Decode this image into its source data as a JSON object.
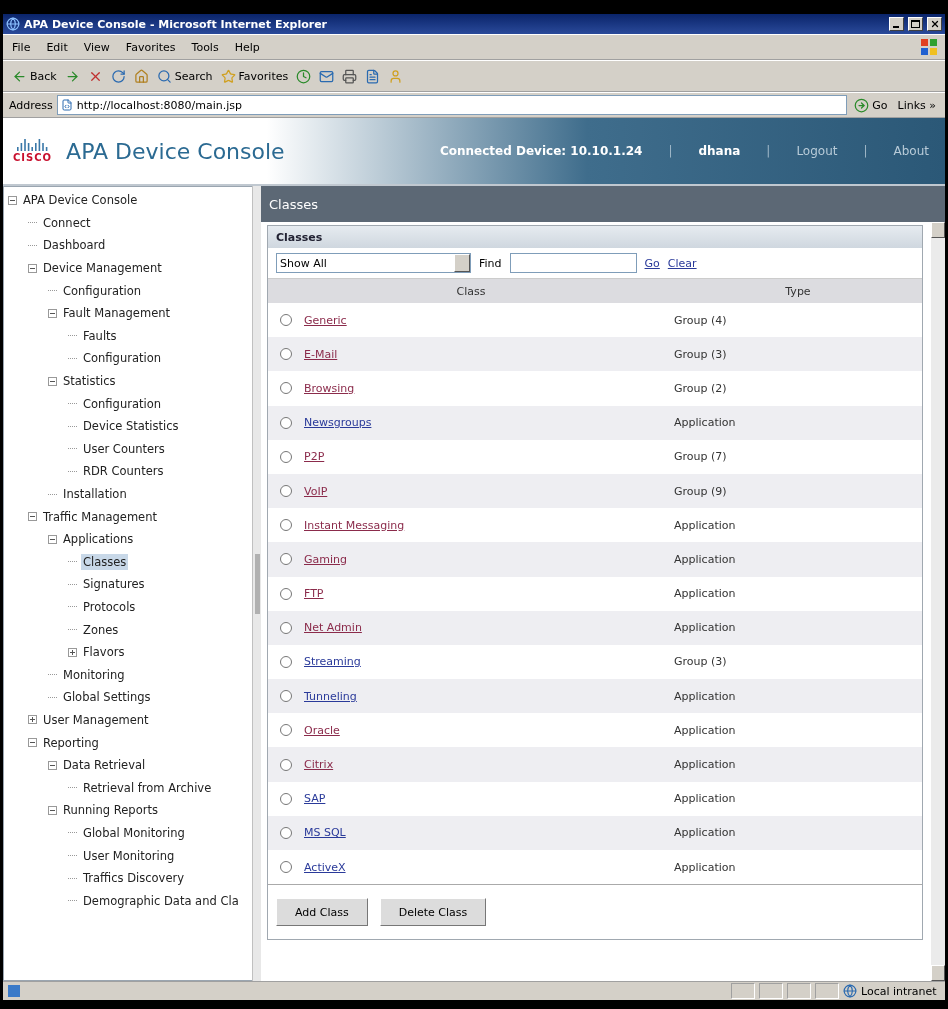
{
  "window": {
    "title": "APA Device Console - Microsoft Internet Explorer"
  },
  "menu": [
    "File",
    "Edit",
    "View",
    "Favorites",
    "Tools",
    "Help"
  ],
  "toolbar": [
    {
      "kind": "back",
      "label": "Back"
    },
    {
      "kind": "forward"
    },
    {
      "kind": "stop"
    },
    {
      "kind": "refresh"
    },
    {
      "kind": "home"
    },
    {
      "kind": "search",
      "label": "Search"
    },
    {
      "kind": "favorites",
      "label": "Favorites"
    },
    {
      "kind": "history"
    },
    {
      "kind": "mail"
    },
    {
      "kind": "print"
    },
    {
      "kind": "edit"
    },
    {
      "kind": "messenger"
    }
  ],
  "address": {
    "label": "Address",
    "value": "http://localhost:8080/main.jsp",
    "go": "Go",
    "links": "Links",
    "more": "»"
  },
  "header": {
    "logo_text": "CISCO",
    "title": "APA Device Console",
    "items": [
      {
        "kind": "label",
        "text": "Connected Device: 10.10.1.24"
      },
      {
        "kind": "separator",
        "text": "|"
      },
      {
        "kind": "user",
        "text": "dhana"
      },
      {
        "kind": "separator",
        "text": "|"
      },
      {
        "kind": "link",
        "text": "Logout"
      },
      {
        "kind": "separator",
        "text": "|"
      },
      {
        "kind": "link",
        "text": "About"
      }
    ]
  },
  "sidebar": {
    "items": [
      {
        "label": "APA Device Console",
        "expanded": true,
        "selected": false,
        "children": [
          {
            "label": "Connect",
            "selected": false
          },
          {
            "label": "Dashboard",
            "selected": false
          },
          {
            "label": "Device Management",
            "expanded": true,
            "selected": false,
            "children": [
              {
                "label": "Configuration",
                "selected": false
              },
              {
                "label": "Fault Management",
                "expanded": true,
                "selected": false,
                "children": [
                  {
                    "label": "Faults",
                    "selected": false
                  },
                  {
                    "label": "Configuration",
                    "selected": false
                  }
                ]
              },
              {
                "label": "Statistics",
                "expanded": true,
                "selected": false,
                "children": [
                  {
                    "label": "Configuration",
                    "selected": false
                  },
                  {
                    "label": "Device Statistics",
                    "selected": false
                  },
                  {
                    "label": "User Counters",
                    "selected": false
                  },
                  {
                    "label": "RDR Counters",
                    "selected": false
                  }
                ]
              },
              {
                "label": "Installation",
                "selected": false
              }
            ]
          },
          {
            "label": "Traffic Management",
            "expanded": true,
            "selected": false,
            "children": [
              {
                "label": "Applications",
                "expanded": true,
                "selected": false,
                "children": [
                  {
                    "label": "Classes",
                    "selected": true
                  },
                  {
                    "label": "Signatures",
                    "selected": false
                  },
                  {
                    "label": "Protocols",
                    "selected": false
                  },
                  {
                    "label": "Zones",
                    "selected": false
                  },
                  {
                    "label": "Flavors",
                    "expanded": false,
                    "selected": false
                  }
                ]
              },
              {
                "label": "Monitoring",
                "selected": false
              },
              {
                "label": "Global Settings",
                "selected": false
              }
            ]
          },
          {
            "label": "User Management",
            "expanded": false,
            "selected": false
          },
          {
            "label": "Reporting",
            "expanded": true,
            "selected": false,
            "children": [
              {
                "label": "Data Retrieval",
                "expanded": true,
                "selected": false,
                "children": [
                  {
                    "label": "Retrieval from Archive",
                    "selected": false
                  }
                ]
              },
              {
                "label": "Running Reports",
                "expanded": true,
                "selected": false,
                "children": [
                  {
                    "label": "Global Monitoring",
                    "selected": false
                  },
                  {
                    "label": "User Monitoring",
                    "selected": false
                  },
                  {
                    "label": "Traffics Discovery",
                    "selected": false
                  },
                  {
                    "label": "Demographic Data and Cla",
                    "selected": false
                  }
                ]
              }
            ]
          }
        ]
      }
    ]
  },
  "page_title": "Classes",
  "panel": {
    "title": "Classes",
    "filter": "Show All",
    "find_label": "Find",
    "go": "Go",
    "clear": "Clear",
    "columns": [
      "Class",
      "Type"
    ],
    "rows": [
      {
        "name": "Generic",
        "type": "Group (4)",
        "visited": true,
        "selected": false
      },
      {
        "name": "E-Mail",
        "type": "Group (3)",
        "visited": true,
        "selected": false
      },
      {
        "name": "Browsing",
        "type": "Group (2)",
        "visited": true,
        "selected": false
      },
      {
        "name": "Newsgroups",
        "type": "Application",
        "visited": false,
        "selected": false
      },
      {
        "name": "P2P",
        "type": "Group (7)",
        "visited": true,
        "selected": false
      },
      {
        "name": "VoIP",
        "type": "Group (9)",
        "visited": true,
        "selected": false
      },
      {
        "name": "Instant Messaging",
        "type": "Application",
        "visited": true,
        "selected": false
      },
      {
        "name": "Gaming",
        "type": "Application",
        "visited": true,
        "selected": false
      },
      {
        "name": "FTP",
        "type": "Application",
        "visited": true,
        "selected": false
      },
      {
        "name": "Net Admin",
        "type": "Application",
        "visited": true,
        "selected": false
      },
      {
        "name": "Streaming",
        "type": "Group (3)",
        "visited": false,
        "selected": false
      },
      {
        "name": "Tunneling",
        "type": "Application",
        "visited": false,
        "selected": false
      },
      {
        "name": "Oracle",
        "type": "Application",
        "visited": true,
        "selected": false
      },
      {
        "name": "Citrix",
        "type": "Application",
        "visited": true,
        "selected": false
      },
      {
        "name": "SAP",
        "type": "Application",
        "visited": false,
        "selected": false
      },
      {
        "name": "MS SQL",
        "type": "Application",
        "visited": false,
        "selected": false
      },
      {
        "name": "ActiveX",
        "type": "Application",
        "visited": false,
        "selected": false
      }
    ],
    "buttons": [
      "Add Class",
      "Delete Class"
    ]
  },
  "status_bar": {
    "zone": "Local intranet"
  }
}
